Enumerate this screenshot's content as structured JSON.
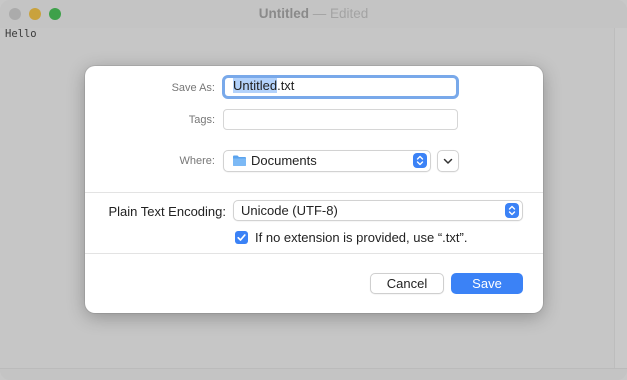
{
  "window": {
    "title": "Untitled",
    "title_separator": " — ",
    "status": "Edited",
    "document_text": "Hello"
  },
  "dialog": {
    "save_as": {
      "label": "Save As:",
      "value_selected": "Untitled",
      "value_extension": ".txt"
    },
    "tags": {
      "label": "Tags:",
      "value": ""
    },
    "where": {
      "label": "Where:",
      "value": "Documents",
      "icon": "folder-icon"
    },
    "encoding": {
      "label": "Plain Text Encoding:",
      "value": "Unicode (UTF-8)"
    },
    "extension_option": {
      "label": "If no extension is provided, use “.txt”.",
      "checked": true
    },
    "cancel_label": "Cancel",
    "save_label": "Save"
  },
  "colors": {
    "accent": "#3b82f6",
    "selection": "#b3d2fb",
    "focus_ring": "#79a9ea"
  }
}
